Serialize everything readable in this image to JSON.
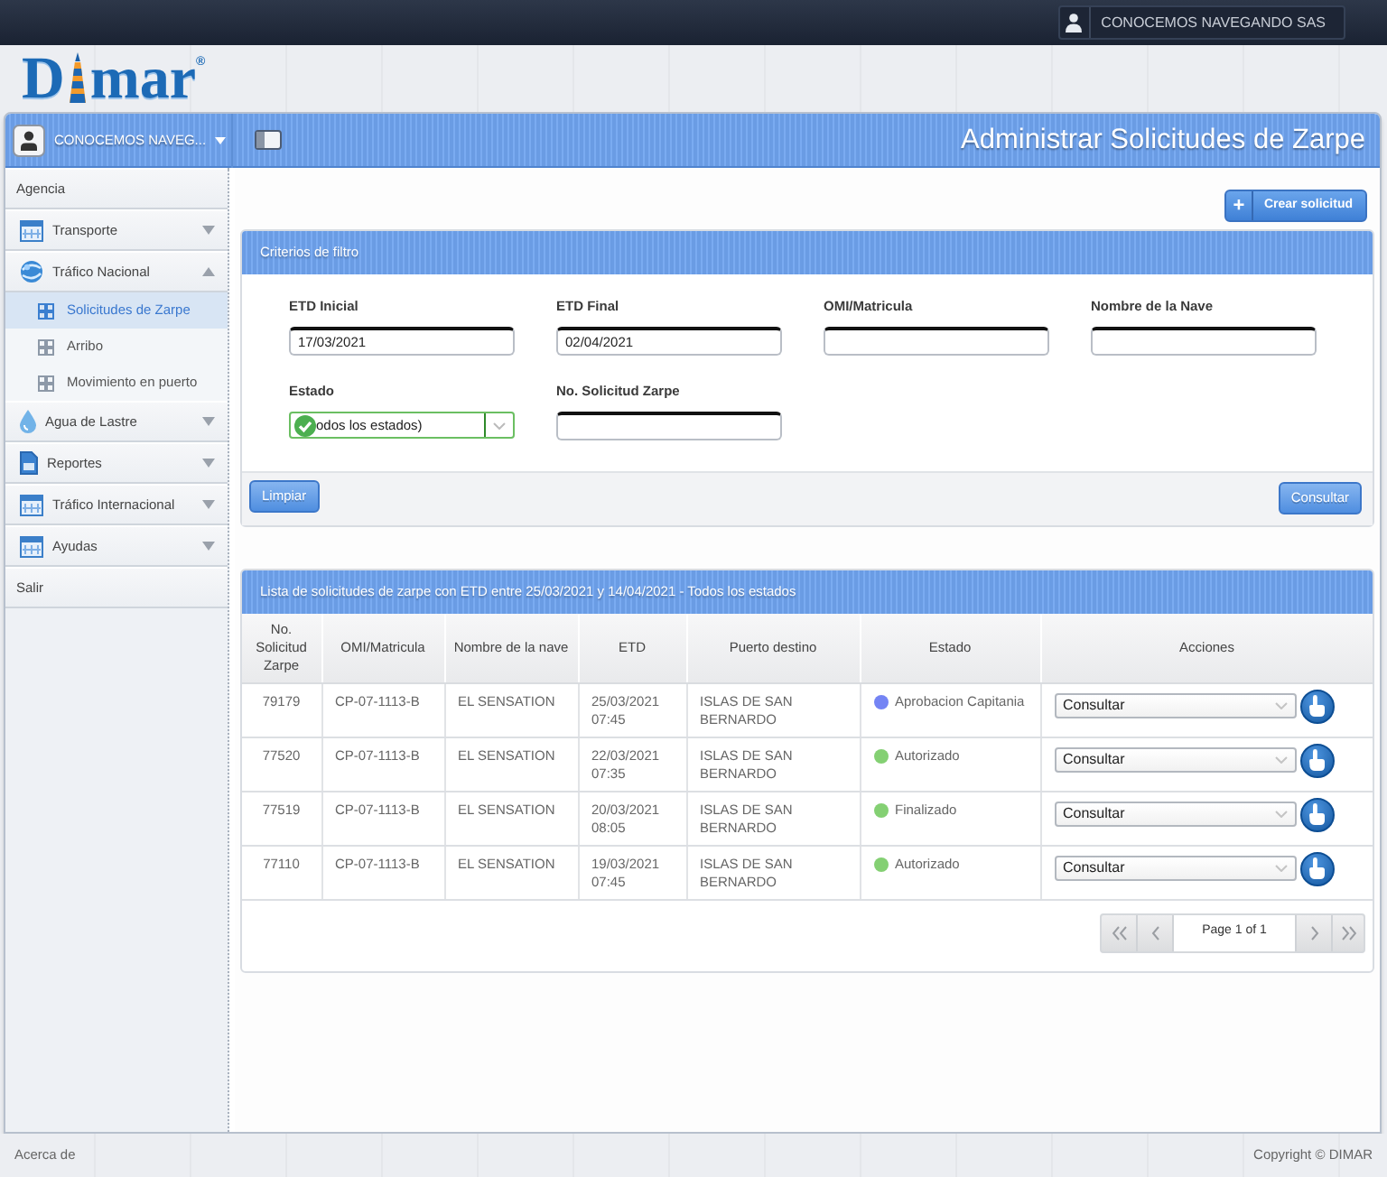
{
  "top_bar": {
    "user": "CONOCEMOS NAVEGANDO SAS"
  },
  "logo": {
    "lead": "D",
    "tail": "mar",
    "mark": "®"
  },
  "account": {
    "name": "CONOCEMOS NAVEG..."
  },
  "page_title": "Administrar Solicitudes de Zarpe",
  "sidebar": {
    "items": [
      {
        "label": "Agencia",
        "kind": "link"
      },
      {
        "label": "Transporte",
        "kind": "group",
        "expanded": false
      },
      {
        "label": "Tráfico Nacional",
        "kind": "group",
        "expanded": true,
        "children": [
          {
            "label": "Solicitudes de Zarpe",
            "selected": true
          },
          {
            "label": "Arribo",
            "selected": false
          },
          {
            "label": "Movimiento en puerto",
            "selected": false
          }
        ]
      },
      {
        "label": "Agua de Lastre",
        "kind": "group",
        "expanded": false
      },
      {
        "label": "Reportes",
        "kind": "group",
        "expanded": false
      },
      {
        "label": "Tráfico Internacional",
        "kind": "group",
        "expanded": false
      },
      {
        "label": "Ayudas",
        "kind": "group",
        "expanded": false
      },
      {
        "label": "Salir",
        "kind": "link"
      }
    ]
  },
  "create_button": {
    "icon": "+",
    "label": "Crear solicitud"
  },
  "filter": {
    "title": "Criterios de filtro",
    "fields": [
      {
        "label": "ETD Inicial",
        "kind": "text",
        "value": "17/03/2021"
      },
      {
        "label": "ETD Final",
        "kind": "text",
        "value": "02/04/2021"
      },
      {
        "label": "OMI/Matricula",
        "kind": "text"
      },
      {
        "label": "Nombre de la Nave",
        "kind": "text"
      },
      {
        "label": "Estado",
        "kind": "select",
        "value": "odos los estados)",
        "valid": true
      },
      {
        "label": "No. Solicitud Zarpe",
        "kind": "text"
      }
    ],
    "buttons": [
      {
        "label": "Limpiar",
        "kind": "reset"
      },
      {
        "label": "Consultar",
        "kind": "submit"
      }
    ]
  },
  "results": {
    "title": "Lista de solicitudes de zarpe con ETD entre 25/03/2021 y 14/04/2021 - Todos los estados",
    "columns": [
      "No. Solicitud Zarpe",
      "OMI/Matricula",
      "Nombre de la nave",
      "ETD",
      "Puerto destino",
      "Estado",
      "Acciones"
    ],
    "rows": [
      {
        "number": "79179",
        "omi": "CP-07-1113-B",
        "vessel": "EL SENSATION",
        "etd": "25/03/2021 07:45",
        "port": "ISLAS DE SAN BERNARDO",
        "status": {
          "label": "Aprobacion Capitania",
          "color": "#7484f4"
        },
        "action": "Consultar"
      },
      {
        "number": "77520",
        "omi": "CP-07-1113-B",
        "vessel": "EL SENSATION",
        "etd": "22/03/2021 07:35",
        "port": "ISLAS DE SAN BERNARDO",
        "status": {
          "label": "Autorizado",
          "color": "#84d073"
        },
        "action": "Consultar"
      },
      {
        "number": "77519",
        "omi": "CP-07-1113-B",
        "vessel": "EL SENSATION",
        "etd": "20/03/2021 08:05",
        "port": "ISLAS DE SAN BERNARDO",
        "status": {
          "label": "Finalizado",
          "color": "#84d073"
        },
        "action": "Consultar"
      },
      {
        "number": "77110",
        "omi": "CP-07-1113-B",
        "vessel": "EL SENSATION",
        "etd": "19/03/2021 07:45",
        "port": "ISLAS DE SAN BERNARDO",
        "status": {
          "label": "Autorizado",
          "color": "#84d073"
        },
        "action": "Consultar"
      }
    ],
    "pager": {
      "text": "Page 1 of 1"
    }
  },
  "footer": {
    "left": "Acerca de",
    "right": "Copyright © DIMAR"
  }
}
